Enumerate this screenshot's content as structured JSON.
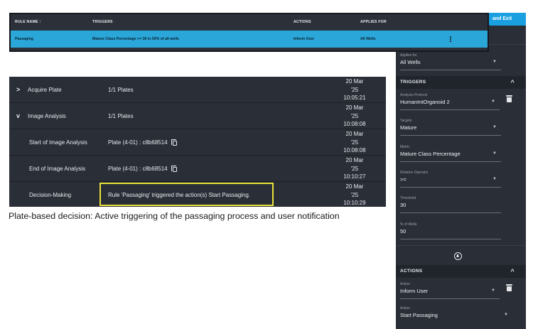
{
  "rules_table": {
    "columns": [
      "RULE NAME ↑",
      "TRIGGERS",
      "ACTIONS",
      "APPLIES FOR"
    ],
    "rows": [
      {
        "rule_name": "Passaging",
        "trigger": "Mature Class Percentage >= 30 in 50% of all wells",
        "action": "Inform User",
        "applies_for": "All Wells"
      }
    ]
  },
  "panel": {
    "save_exit_label": "and Exit",
    "applies_for": {
      "label": "Applies for",
      "value": "All Wells"
    },
    "triggers_section": "TRIGGERS",
    "analysis_protocol": {
      "label": "Analysis Protocol",
      "value": "HumanIntOrganoid 2"
    },
    "targets": {
      "label": "Targets",
      "value": "Mature"
    },
    "metric": {
      "label": "Metric",
      "value": "Mature  Class Percentage"
    },
    "relation_operator": {
      "label": "Relation Operator",
      "value": ">="
    },
    "threshold": {
      "label": "Threshold",
      "value": "30"
    },
    "percent_wells": {
      "label": "% of Wells",
      "value": "50"
    },
    "actions_section": "ACTIONS",
    "action": {
      "label": "Action",
      "value": "Inform User"
    },
    "action2": {
      "label": "Action",
      "value": "Start Passaging"
    }
  },
  "events": [
    {
      "name": "Acquire Plate",
      "info": "1/1 Plates",
      "date": [
        "20 Mar",
        "'25",
        "10:05:21"
      ],
      "toggle": "collapsed"
    },
    {
      "name": "Image Analysis",
      "info": "1/1 Plates",
      "date": [
        "20 Mar",
        "'25",
        "10:08:08"
      ],
      "toggle": "expanded"
    },
    {
      "name": "Start of Image Analysis",
      "info": "Plate (4-01) : c8b68514",
      "date": [
        "20 Mar",
        "'25",
        "10:08:08"
      ]
    },
    {
      "name": "End of Image Analysis",
      "info": "Plate (4-01) : c8b68514",
      "date": [
        "20 Mar",
        "'25",
        "10:10:27"
      ]
    },
    {
      "name": "Decision-Making",
      "info": "Rule 'Passaging' triggered the action(s) Start Passaging.",
      "date": [
        "20 Mar",
        "'25",
        "10:10:29"
      ]
    }
  ],
  "caption": "Plate-based decision: Active triggering of the passaging process and user notification",
  "colors": {
    "accent": "#2aa6d9",
    "panel_bg": "#2a2e36",
    "highlight": "#e8e23a",
    "save_button": "#1aa0e0"
  }
}
